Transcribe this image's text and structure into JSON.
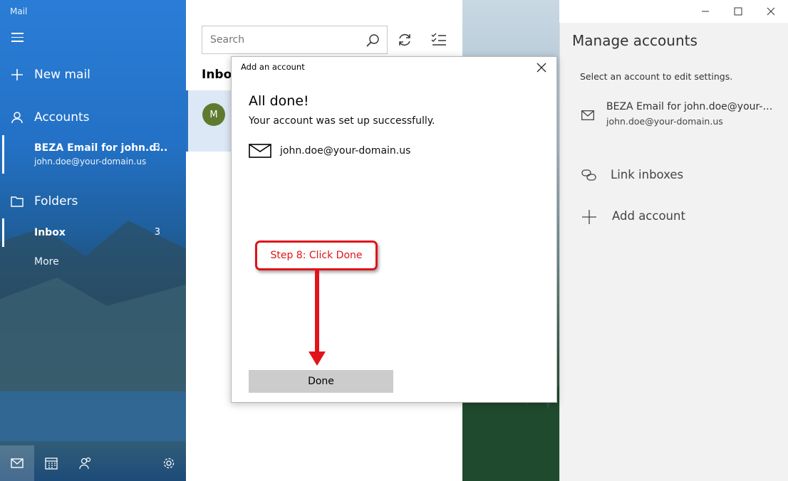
{
  "app": {
    "title": "Mail"
  },
  "nav": {
    "new_mail": "New mail",
    "accounts_header": "Accounts",
    "account": {
      "name": "BEZA Email for john.d...",
      "email": "john.doe@your-domain.us",
      "count": "3"
    },
    "folders_header": "Folders",
    "inbox": {
      "label": "Inbox",
      "count": "3"
    },
    "more": "More"
  },
  "list": {
    "search_placeholder": "Search",
    "inbox_title": "Inbox",
    "message": {
      "avatar_initial": "M"
    }
  },
  "manage": {
    "title": "Manage accounts",
    "subtitle": "Select an account to edit settings.",
    "account": {
      "name": "BEZA Email for john.doe@your-domain.us",
      "email": "john.doe@your-domain.us"
    },
    "link_inboxes": "Link inboxes",
    "add_account": "Add account"
  },
  "dialog": {
    "title": "Add an account",
    "heading": "All done!",
    "message": "Your account was set up successfully.",
    "email": "john.doe@your-domain.us",
    "done_label": "Done"
  },
  "annotation": {
    "text": "Step 8: Click Done",
    "color": "#e0141a"
  },
  "colors": {
    "nav_blue": "#2a7dd6",
    "accent": "#2b72c2",
    "avatar": "#5f7a2e"
  }
}
